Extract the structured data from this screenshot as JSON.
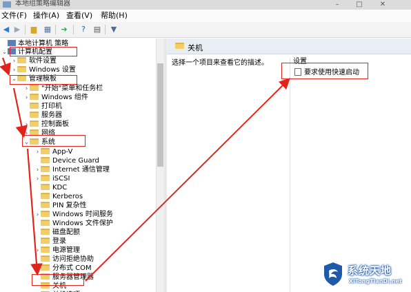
{
  "window": {
    "title": "本地组策略编辑器",
    "minimize": "–",
    "maximize": "□",
    "close": "✕"
  },
  "menu": [
    "文件(F)",
    "操作(A)",
    "查看(V)",
    "帮助(H)"
  ],
  "toolbar": {
    "icons": [
      "back-icon",
      "forward-icon",
      "folder-up-icon",
      "show-tree-icon",
      "export-icon",
      "help-icon",
      "properties-icon",
      "filter-icon"
    ]
  },
  "tree": {
    "rows": [
      {
        "label": "本地计算机 策略",
        "icon": "computer",
        "expander": "",
        "level": 0
      },
      {
        "label": "计算机配置",
        "icon": "computer",
        "expander": "⌄",
        "level": 0
      },
      {
        "label": "软件设置",
        "icon": "folder",
        "expander": "›",
        "level": 1
      },
      {
        "label": "Windows 设置",
        "icon": "folder",
        "expander": "›",
        "level": 1
      },
      {
        "label": "管理模板",
        "icon": "folder",
        "expander": "⌄",
        "level": 1
      },
      {
        "label": "\"开始\"菜单和任务栏",
        "icon": "folder",
        "expander": "›",
        "level": 2
      },
      {
        "label": "Windows 组件",
        "icon": "folder",
        "expander": "›",
        "level": 2
      },
      {
        "label": "打印机",
        "icon": "folder",
        "expander": "",
        "level": 2
      },
      {
        "label": "服务器",
        "icon": "folder",
        "expander": "",
        "level": 2
      },
      {
        "label": "控制面板",
        "icon": "folder",
        "expander": "›",
        "level": 2
      },
      {
        "label": "网络",
        "icon": "folder",
        "expander": "›",
        "level": 2
      },
      {
        "label": "系统",
        "icon": "folder",
        "expander": "⌄",
        "level": 2
      },
      {
        "label": "App-V",
        "icon": "folder",
        "expander": "›",
        "level": 3
      },
      {
        "label": "Device Guard",
        "icon": "folder",
        "expander": "",
        "level": 3
      },
      {
        "label": "Internet 通信管理",
        "icon": "folder",
        "expander": "›",
        "level": 3
      },
      {
        "label": "iSCSI",
        "icon": "folder",
        "expander": "›",
        "level": 3
      },
      {
        "label": "KDC",
        "icon": "folder",
        "expander": "",
        "level": 3
      },
      {
        "label": "Kerberos",
        "icon": "folder",
        "expander": "",
        "level": 3
      },
      {
        "label": "PIN 复杂性",
        "icon": "folder",
        "expander": "",
        "level": 3
      },
      {
        "label": "Windows 时间服务",
        "icon": "folder",
        "expander": "›",
        "level": 3
      },
      {
        "label": "Windows 文件保护",
        "icon": "folder",
        "expander": "",
        "level": 3
      },
      {
        "label": "磁盘配额",
        "icon": "folder",
        "expander": "",
        "level": 3
      },
      {
        "label": "登录",
        "icon": "folder",
        "expander": "",
        "level": 3
      },
      {
        "label": "电源管理",
        "icon": "folder",
        "expander": "›",
        "level": 3
      },
      {
        "label": "访问拒绝协助",
        "icon": "folder",
        "expander": "",
        "level": 3
      },
      {
        "label": "分布式 COM",
        "icon": "folder",
        "expander": "›",
        "level": 3
      },
      {
        "label": "服务器管理器",
        "icon": "folder",
        "expander": "",
        "level": 3
      },
      {
        "label": "关机",
        "icon": "folder",
        "expander": "",
        "level": 3
      },
      {
        "label": "关机选项",
        "icon": "folder",
        "expander": "",
        "level": 3
      }
    ]
  },
  "right_pane": {
    "header": "关机",
    "description": "选择一个项目来查看它的描述。",
    "column_header": "设置",
    "items": [
      "要求使用快速启动"
    ]
  },
  "watermark": {
    "name": "系统天地",
    "domain": "XiTongTianDi.net"
  },
  "colors": {
    "highlight": "#e2231a",
    "pane_header": "#e9eef5",
    "folder": "#f2ce6b",
    "watermark": "#1f5aa8"
  }
}
